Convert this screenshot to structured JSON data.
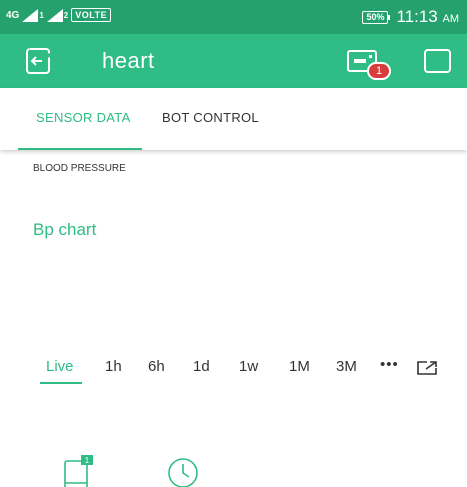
{
  "status_bar": {
    "network": "4G",
    "sim_sub": "1",
    "sim_sub2": "2",
    "volte": "VOLTE",
    "battery": "50%",
    "time": "11:13",
    "ampm": "AM"
  },
  "app_bar": {
    "title": "heart",
    "notification_count": "1"
  },
  "tabs": [
    {
      "label": "SENSOR DATA"
    },
    {
      "label": "BOT CONTROL"
    }
  ],
  "section": {
    "label": "BLOOD PRESSURE",
    "chart_title": "Bp chart"
  },
  "time_ranges": [
    {
      "label": "Live"
    },
    {
      "label": "1h"
    },
    {
      "label": "6h"
    },
    {
      "label": "1d"
    },
    {
      "label": "1w"
    },
    {
      "label": "1M"
    },
    {
      "label": "3M"
    }
  ],
  "more_label": "•••",
  "widget_badge": "1",
  "colors": {
    "status_bar": "#24a16d",
    "app_bar": "#2fbc85",
    "accent": "#2fbc85",
    "badge": "#d93c3c"
  },
  "icons": [
    "back-icon",
    "device-icon",
    "square-icon",
    "expand-icon",
    "tablet-icon",
    "clock-icon"
  ]
}
